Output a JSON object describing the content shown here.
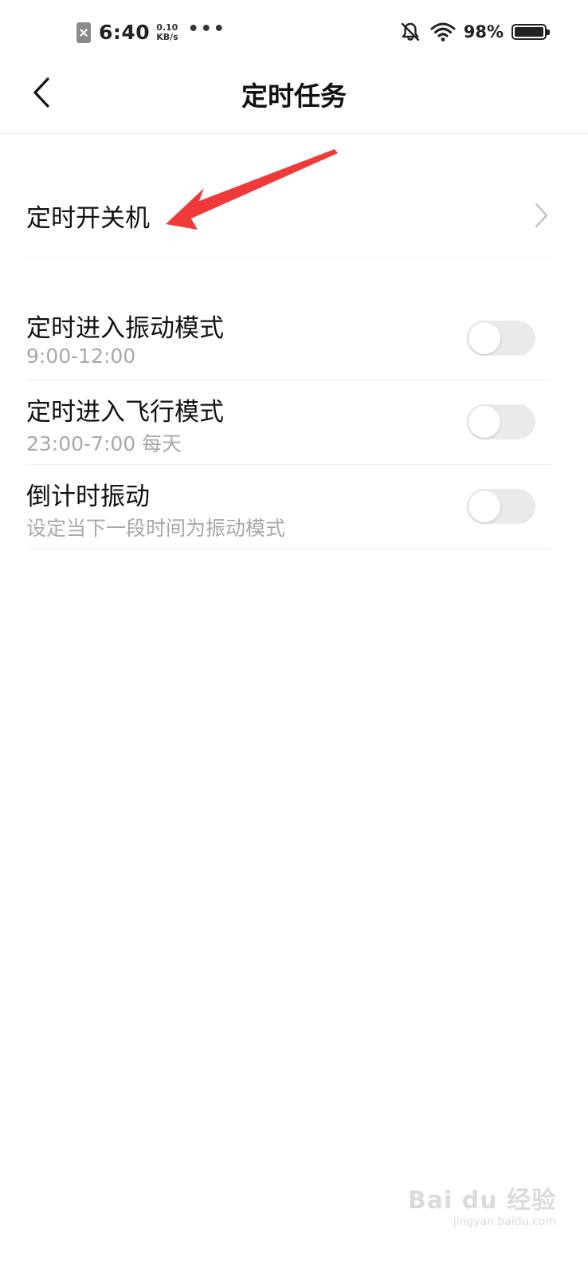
{
  "status_bar": {
    "time": "6:40",
    "net_speed_value": "0.10",
    "net_speed_unit": "KB/s",
    "more_dots": "•••",
    "battery_percent": "98%",
    "icons": [
      "sim-error-icon",
      "bell-off-icon",
      "wifi-icon",
      "battery-icon"
    ]
  },
  "header": {
    "title": "定时任务",
    "back_icon": "chevron-left-icon"
  },
  "items": [
    {
      "title": "定时开关机",
      "control": "chevron"
    },
    {
      "title": "定时进入振动模式",
      "subtitle": "9:00-12:00",
      "control": "toggle",
      "enabled": false
    },
    {
      "title": "定时进入飞行模式",
      "subtitle": "23:00-7:00 每天",
      "control": "toggle",
      "enabled": false
    },
    {
      "title": "倒计时振动",
      "subtitle": "设定当下一段时间为振动模式",
      "control": "toggle",
      "enabled": false
    }
  ],
  "annotation": {
    "color": "#f03a3a"
  },
  "watermark": {
    "main": "Bai du 经验",
    "sub": "jingyan.baidu.com"
  },
  "colors": {
    "title_text": "#111111",
    "subtitle_text": "#a8a8a8",
    "toggle_off_track": "#eaeaea",
    "divider": "#eeeeee"
  }
}
